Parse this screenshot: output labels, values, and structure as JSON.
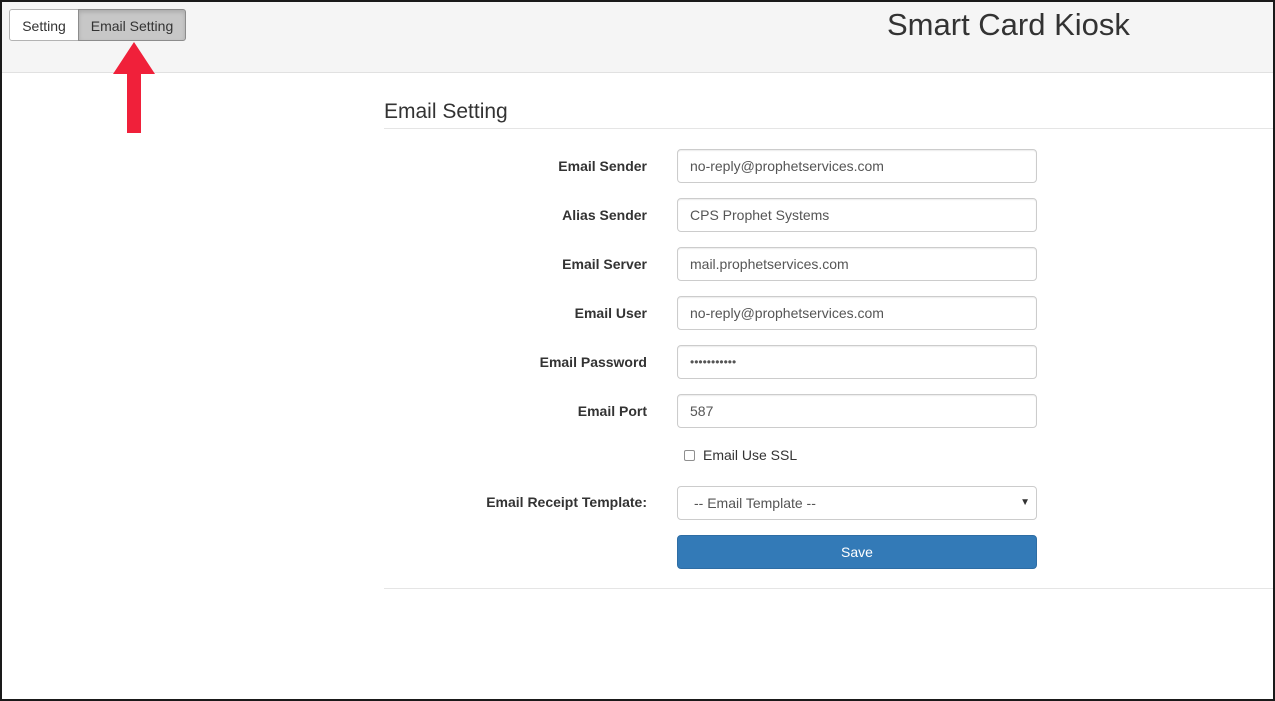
{
  "header": {
    "app_title": "Smart Card Kiosk",
    "tabs": [
      {
        "label": "Setting",
        "active": false
      },
      {
        "label": "Email Setting",
        "active": true
      }
    ]
  },
  "form": {
    "section_title": "Email Setting",
    "fields": [
      {
        "label": "Email Sender",
        "value": "no-reply@prophetservices.com"
      },
      {
        "label": "Alias Sender",
        "value": "CPS Prophet Systems"
      },
      {
        "label": "Email Server",
        "value": "mail.prophetservices.com"
      },
      {
        "label": "Email User",
        "value": "no-reply@prophetservices.com"
      },
      {
        "label": "Email Password",
        "value": "•••••••••••"
      },
      {
        "label": "Email Port",
        "value": "587"
      }
    ],
    "ssl_checkbox": {
      "label": "Email Use SSL",
      "checked": false
    },
    "template": {
      "label": "Email Receipt Template:",
      "selected": "-- Email Template --",
      "icon": "caret-down-icon"
    },
    "save_label": "Save"
  },
  "colors": {
    "primary_button": "#337ab7",
    "annotation_arrow": "#f0203a",
    "active_tab": "#c7c7c7"
  }
}
